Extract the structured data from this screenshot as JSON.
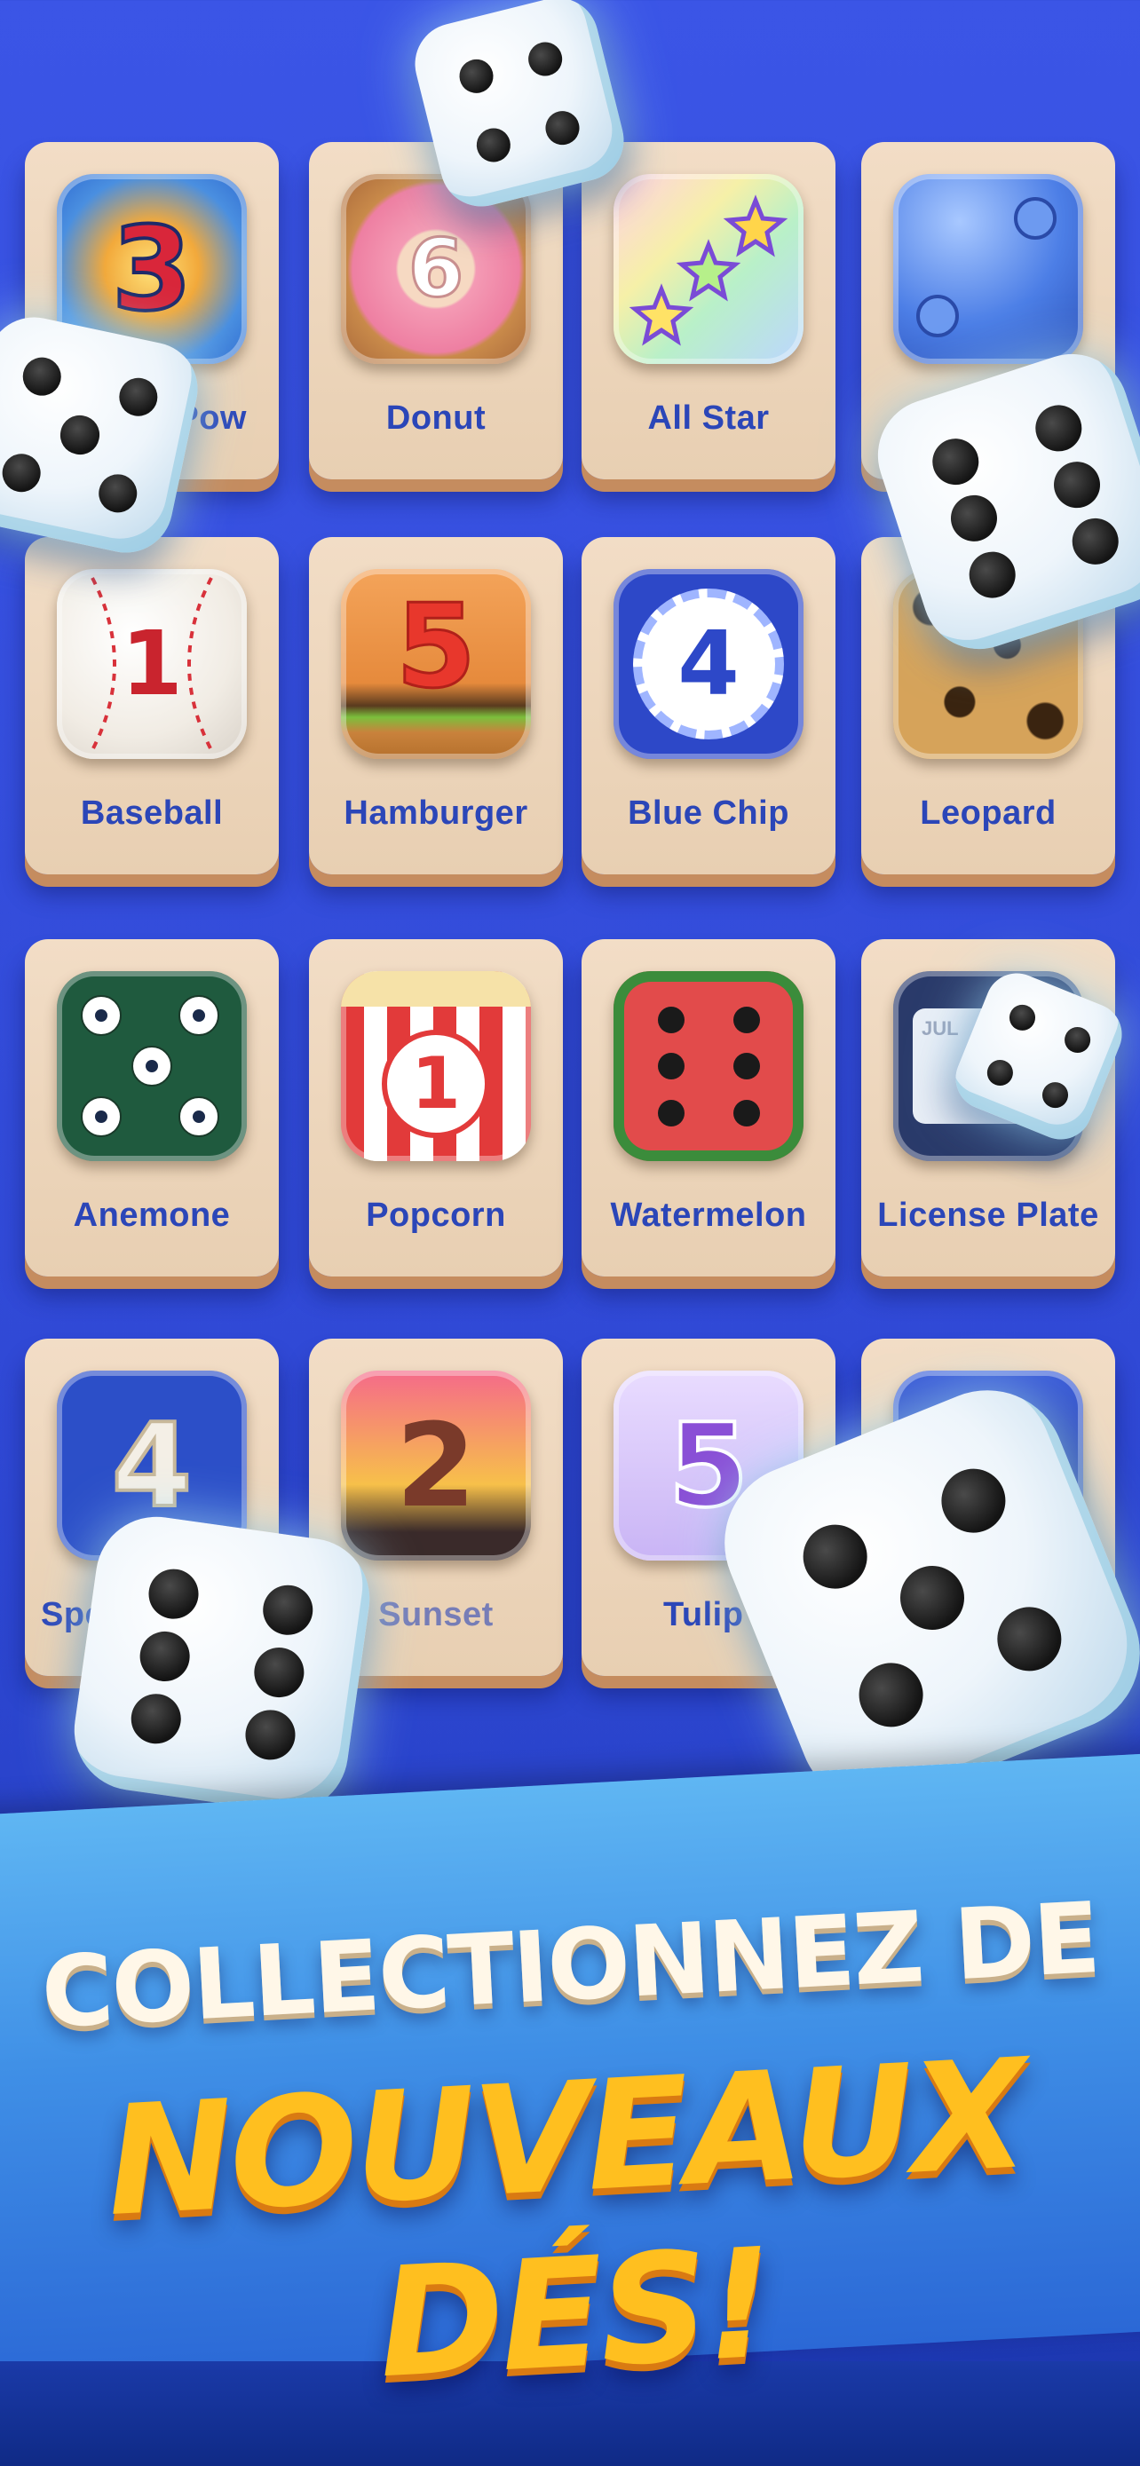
{
  "cards": [
    {
      "label": "Pow",
      "tile": "comic-burst",
      "num": "3",
      "icon": "comic-3-icon"
    },
    {
      "label": "Donut",
      "tile": "donut",
      "num": "6",
      "icon": "donut-icon"
    },
    {
      "label": "All Star",
      "tile": "stars",
      "num": "",
      "icon": "stars-icon"
    },
    {
      "label": "",
      "tile": "glass-blue",
      "num": "",
      "icon": "blue-glass-die-icon"
    },
    {
      "label": "Baseball",
      "tile": "baseball",
      "num": "1",
      "icon": "baseball-icon"
    },
    {
      "label": "Hamburger",
      "tile": "burger",
      "num": "5",
      "icon": "hamburger-icon"
    },
    {
      "label": "Blue Chip",
      "tile": "chip",
      "num": "4",
      "icon": "poker-chip-icon"
    },
    {
      "label": "Leopard",
      "tile": "leopard",
      "num": "",
      "icon": "leopard-icon"
    },
    {
      "label": "Anemone",
      "tile": "anemone",
      "num": "",
      "icon": "anemone-flower-icon"
    },
    {
      "label": "Popcorn",
      "tile": "popcorn",
      "num": "1",
      "icon": "popcorn-icon"
    },
    {
      "label": "Watermelon",
      "tile": "watermelon",
      "num": "",
      "icon": "watermelon-icon"
    },
    {
      "label": "License Plate",
      "tile": "plate",
      "num": "",
      "icon": "license-plate-icon"
    },
    {
      "label": "Spo",
      "tile": "sports",
      "num": "4",
      "icon": "sports-jersey-icon"
    },
    {
      "label": "Sunset",
      "tile": "sunset",
      "num": "2",
      "icon": "sunset-icon"
    },
    {
      "label": "Tulip",
      "tile": "tulip",
      "num": "5",
      "icon": "tulip-icon"
    },
    {
      "label": "",
      "tile": "dark-blue",
      "num": "",
      "icon": "dark-blue-die-icon"
    }
  ],
  "plate_text": "JUL",
  "headline": {
    "line1": "COLLECTIONNEZ DE",
    "line2": "NOUVEAUX DÉS!"
  },
  "colors": {
    "background": "#3b55e6",
    "card": "#f2ddc6",
    "card_label": "#2b46b8",
    "headline_line1": "#fff7e8",
    "headline_line2": "#ffbf1f"
  }
}
